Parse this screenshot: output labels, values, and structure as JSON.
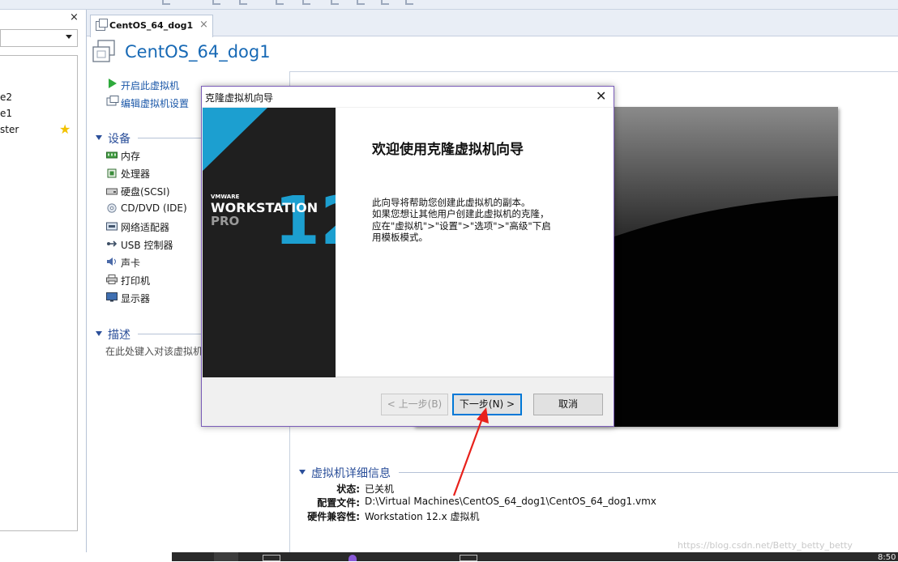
{
  "library": {
    "close_glyph": "×",
    "items": [
      "e2",
      "e1",
      "ster"
    ]
  },
  "tab": {
    "label": "CentOS_64_dog1",
    "close_glyph": "×"
  },
  "vm": {
    "title": "CentOS_64_dog1"
  },
  "commands": {
    "power_on": "开启此虚拟机",
    "edit_settings": "编辑虚拟机设置"
  },
  "devices": {
    "header": "设备",
    "items": [
      {
        "label": "内存",
        "icon": "memory-icon"
      },
      {
        "label": "处理器",
        "icon": "cpu-icon"
      },
      {
        "label": "硬盘(SCSI)",
        "icon": "harddisk-icon"
      },
      {
        "label": "CD/DVD (IDE)",
        "icon": "cdrom-icon"
      },
      {
        "label": "网络适配器",
        "icon": "network-icon"
      },
      {
        "label": "USB 控制器",
        "icon": "usb-icon"
      },
      {
        "label": "声卡",
        "icon": "sound-icon"
      },
      {
        "label": "打印机",
        "icon": "printer-icon"
      },
      {
        "label": "显示器",
        "icon": "display-icon"
      }
    ]
  },
  "description": {
    "header": "描述",
    "placeholder": "在此处键入对该虚拟机"
  },
  "details": {
    "header": "虚拟机详细信息",
    "status_key": "状态:",
    "status_val": "已关机",
    "config_key": "配置文件:",
    "config_val": "D:\\Virtual Machines\\CentOS_64_dog1\\CentOS_64_dog1.vmx",
    "compat_key": "硬件兼容性:",
    "compat_val": "Workstation 12.x 虚拟机"
  },
  "wizard": {
    "title": "克隆虚拟机向导",
    "close_glyph": "✕",
    "heading": "欢迎使用克隆虚拟机向导",
    "body_lines": [
      "此向导将帮助您创建此虚拟机的副本。",
      "如果您想让其他用户创建此虚拟机的克隆，",
      "应在\"虚拟机\">\"设置\">\"选项\">\"高级\"下启",
      "用模板模式。"
    ],
    "brand": {
      "vmware": "VMWARE",
      "product": "WORKSTATION",
      "edition": "PRO",
      "version": "12"
    },
    "buttons": {
      "back": "< 上一步(B)",
      "next": "下一步(N) >",
      "cancel": "取消"
    }
  },
  "footer": {
    "watermark": "https://blog.csdn.net/Betty_betty_betty",
    "clock": "8:50"
  },
  "colors": {
    "accent_blue": "#1769b5",
    "annotation_arrow": "#e8211b",
    "brand_teal": "#1c9fd0"
  }
}
